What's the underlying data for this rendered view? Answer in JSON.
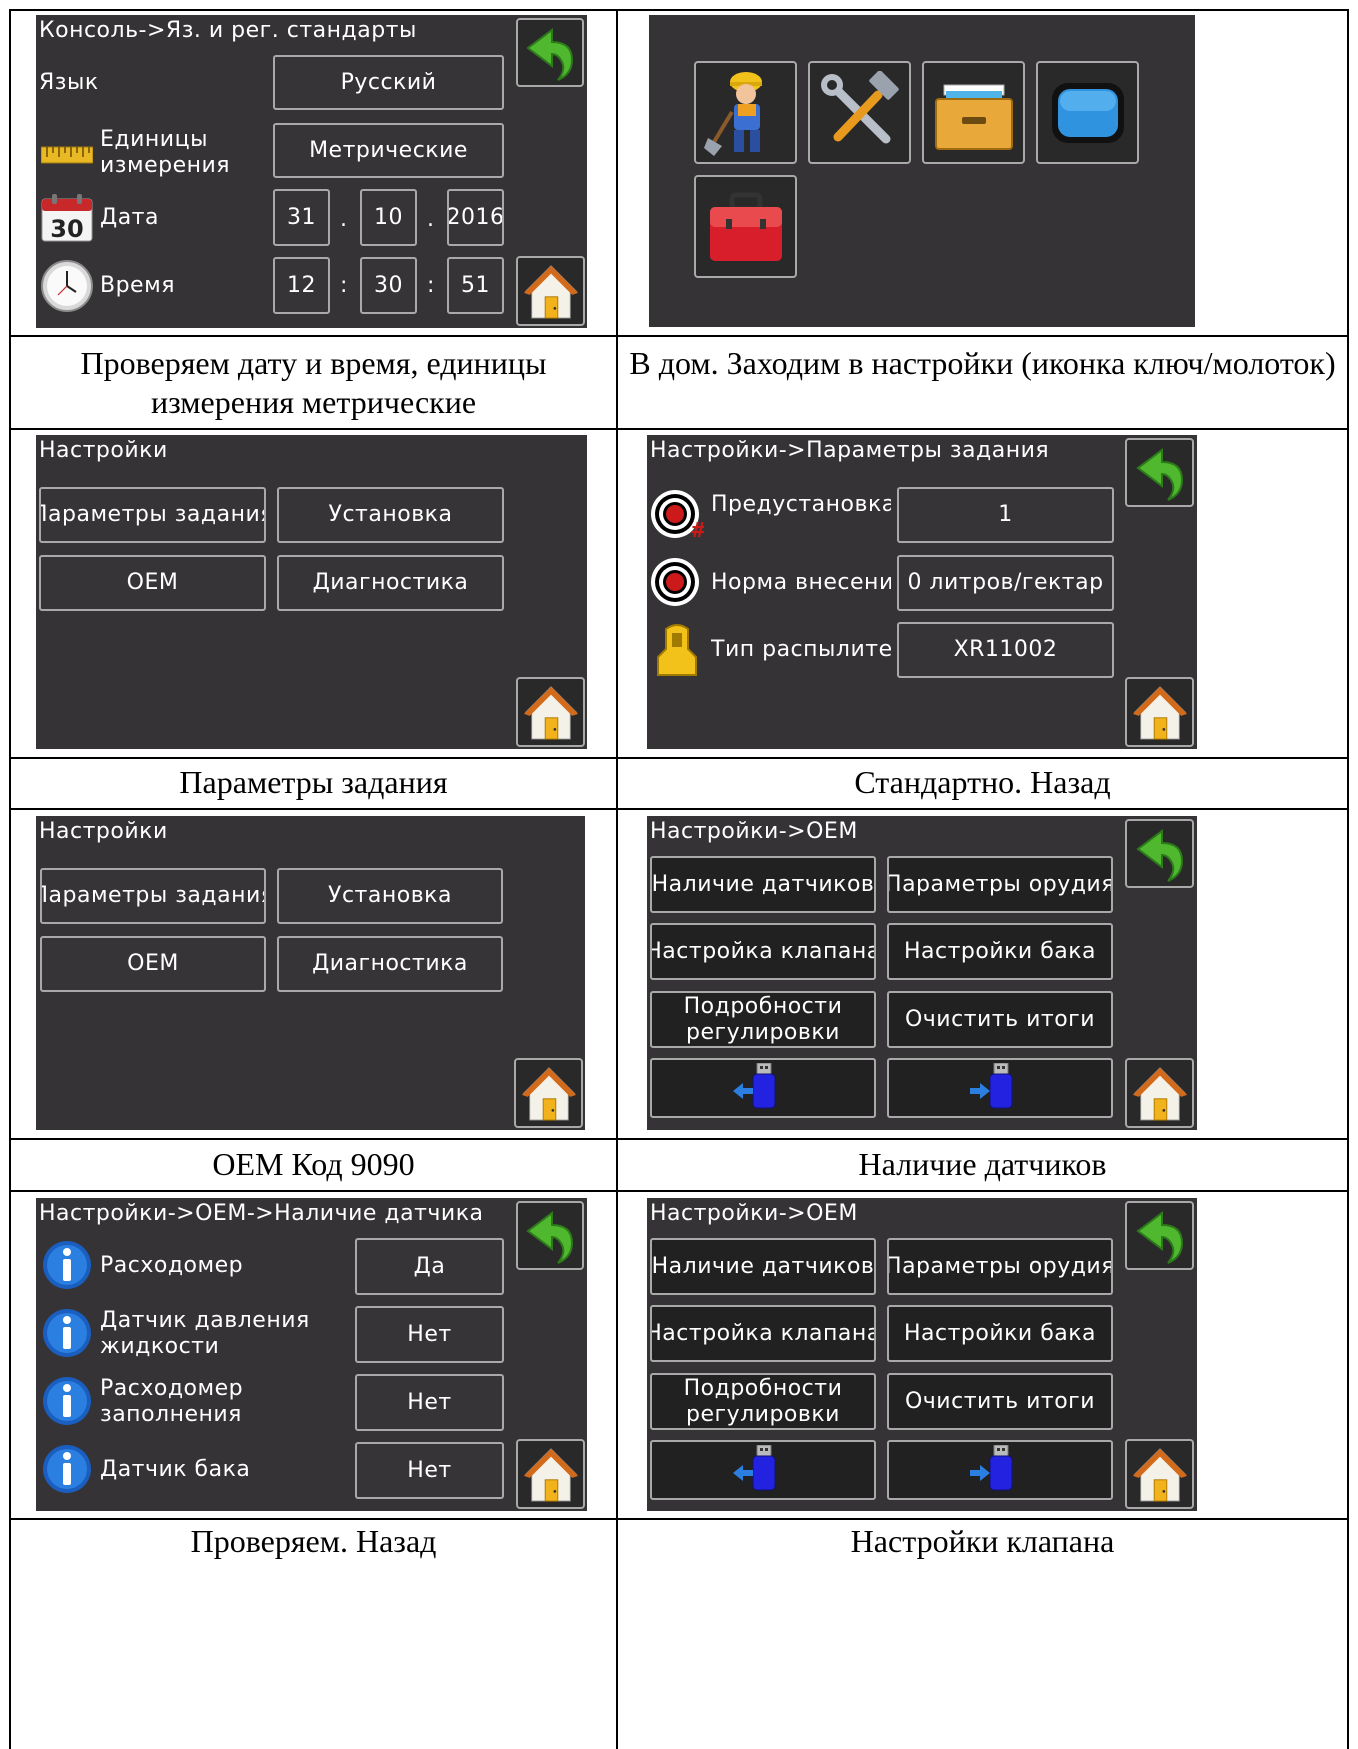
{
  "captions": {
    "c1": "Проверяем дату и время, единицы измерения метрические",
    "c2": "В дом. Заходим в настройки (иконка ключ/молоток)",
    "c3": "Параметры задания",
    "c4": "Стандартно. Назад",
    "c5": "OEM Код 9090",
    "c6": "Наличие датчиков",
    "c7": "Проверяем. Назад",
    "c8": "Настройки клапана"
  },
  "screen1": {
    "title": "Консоль->Яз. и рег. стандарты",
    "language_label": "Язык",
    "language_value": "Русский",
    "units_label": "Единицы измерения",
    "units_value": "Метрические",
    "calendar_day": "30",
    "date_label": "Дата",
    "date_day": "31",
    "date_month": "10",
    "date_year": "2016",
    "date_sep": ".",
    "time_label": "Время",
    "time_hour": "12",
    "time_min": "30",
    "time_sec": "51",
    "time_sep": ":"
  },
  "settings_menu": {
    "title": "Настройки",
    "job_params": "Параметры задания",
    "setup": "Установка",
    "oem": "OEM",
    "diagnostics": "Диагностика"
  },
  "job_params": {
    "title": "Настройки->Параметры задания",
    "preset_rate_label": "Предустановка нормы внесения",
    "preset_rate_value": "1",
    "rate_label": "Норма внесения",
    "rate_value": "0 литров/гектар",
    "nozzle_label": "Тип распылителя",
    "nozzle_value": "XR11002"
  },
  "oem_menu": {
    "title": "Настройки->OEM",
    "sensors": "Наличие датчиков",
    "implement": "Параметры орудия",
    "valve": "Настройка клапана",
    "tank": "Настройки бака",
    "regulation": "Подробности регулировки",
    "clear_totals": "Очистить итоги"
  },
  "sensors_screen": {
    "title": "Настройки->OEM->Наличие датчика",
    "flowmeter_label": "Расходомер",
    "flowmeter_value": "Да",
    "pressure_label": "Датчик давления жидкости",
    "pressure_value": "Нет",
    "fill_flow_label": "Расходомер заполнения",
    "fill_flow_value": "Нет",
    "tank_label": "Датчик бака",
    "tank_value": "Нет"
  },
  "colors": {
    "screen_bg": "#353335",
    "button_border": "#a9a9a9",
    "back_arrow": "#4fb82f",
    "usb_blue": "#2222e0"
  }
}
